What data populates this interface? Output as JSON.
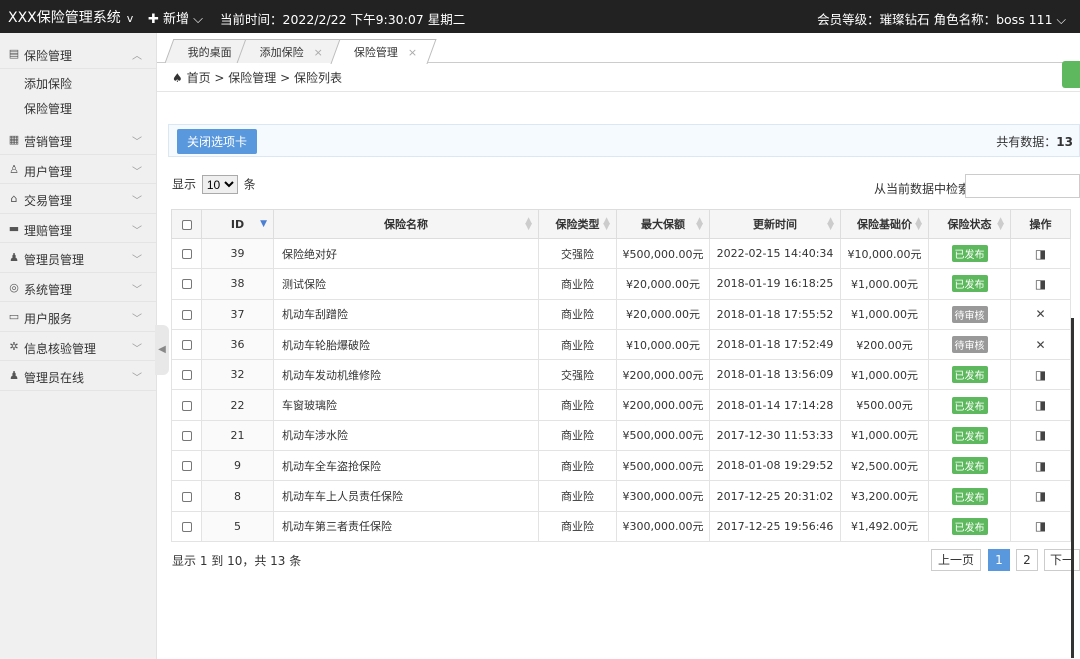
{
  "topbar": {
    "brand": "XXX保险管理系统",
    "brand_caret": "v",
    "new_label": "✚ 新增 ⌵",
    "time_label": "当前时间：2022/2/22 下午9:30:07 星期二",
    "member_label": "会员等级：璀璨钻石 角色名称：boss  111 ⌵"
  },
  "sidebar": {
    "items": [
      {
        "label": "保险管理",
        "icon": "insurance-icon",
        "glyph": "▤",
        "arrow": "︿"
      },
      {
        "label": "营销管理",
        "icon": "marketing-icon",
        "glyph": "▦",
        "arrow": "﹀"
      },
      {
        "label": "用户管理",
        "icon": "user-icon",
        "glyph": "♙",
        "arrow": "﹀"
      },
      {
        "label": "交易管理",
        "icon": "trade-icon",
        "glyph": "⌂",
        "arrow": "﹀"
      },
      {
        "label": "理赔管理",
        "icon": "claim-icon",
        "glyph": "▬",
        "arrow": "﹀"
      },
      {
        "label": "管理员管理",
        "icon": "admin-icon",
        "glyph": "♟",
        "arrow": "﹀"
      },
      {
        "label": "系统管理",
        "icon": "system-icon",
        "glyph": "◎",
        "arrow": "﹀"
      },
      {
        "label": "用户服务",
        "icon": "service-icon",
        "glyph": "▭",
        "arrow": "﹀"
      },
      {
        "label": "信息核验管理",
        "icon": "verify-icon",
        "glyph": "✲",
        "arrow": "﹀"
      },
      {
        "label": "管理员在线",
        "icon": "online-icon",
        "glyph": "♟",
        "arrow": "﹀"
      }
    ],
    "submenu": [
      "添加保险",
      "保险管理"
    ]
  },
  "tabs": [
    {
      "label": "我的桌面",
      "closable": false
    },
    {
      "label": "添加保险",
      "closable": true
    },
    {
      "label": "保险管理",
      "closable": true,
      "active": true
    }
  ],
  "tab_close_glyph": "×",
  "breadcrumb": "♠ 首页  >  保险管理  >  保险列表",
  "toolbar": {
    "close_tabs": "关闭选项卡",
    "total_label": "共有数据：",
    "total_value": "13"
  },
  "length_menu": {
    "prefix": "显示",
    "value": "10",
    "suffix": "条"
  },
  "search": {
    "label": "从当前数据中检索:",
    "value": ""
  },
  "table": {
    "headers": [
      "ID",
      "保险名称",
      "保险类型",
      "最大保额",
      "更新时间",
      "保险基础价",
      "保险状态",
      "操作"
    ],
    "rows": [
      {
        "id": "39",
        "name": "保险绝对好",
        "type": "交强险",
        "max": "¥500,000.00元",
        "time": "2022-02-15 14:40:34",
        "price": "¥10,000.00元",
        "status": "已发布",
        "op": "publish"
      },
      {
        "id": "38",
        "name": "测试保险",
        "type": "商业险",
        "max": "¥20,000.00元",
        "time": "2018-01-19 16:18:25",
        "price": "¥1,000.00元",
        "status": "已发布",
        "op": "publish"
      },
      {
        "id": "37",
        "name": "机动车刮蹭险",
        "type": "商业险",
        "max": "¥20,000.00元",
        "time": "2018-01-18 17:55:52",
        "price": "¥1,000.00元",
        "status": "待审核",
        "op": "review"
      },
      {
        "id": "36",
        "name": "机动车轮胎爆破险",
        "type": "商业险",
        "max": "¥10,000.00元",
        "time": "2018-01-18 17:52:49",
        "price": "¥200.00元",
        "status": "待审核",
        "op": "review"
      },
      {
        "id": "32",
        "name": "机动车发动机维修险",
        "type": "交强险",
        "max": "¥200,000.00元",
        "time": "2018-01-18 13:56:09",
        "price": "¥1,000.00元",
        "status": "已发布",
        "op": "publish"
      },
      {
        "id": "22",
        "name": "车窗玻璃险",
        "type": "商业险",
        "max": "¥200,000.00元",
        "time": "2018-01-14 17:14:28",
        "price": "¥500.00元",
        "status": "已发布",
        "op": "publish"
      },
      {
        "id": "21",
        "name": "机动车涉水险",
        "type": "商业险",
        "max": "¥500,000.00元",
        "time": "2017-12-30 11:53:33",
        "price": "¥1,000.00元",
        "status": "已发布",
        "op": "publish"
      },
      {
        "id": "9",
        "name": "机动车全车盗抢保险",
        "type": "商业险",
        "max": "¥500,000.00元",
        "time": "2018-01-08 19:29:52",
        "price": "¥2,500.00元",
        "status": "已发布",
        "op": "publish"
      },
      {
        "id": "8",
        "name": "机动车车上人员责任保险",
        "type": "商业险",
        "max": "¥300,000.00元",
        "time": "2017-12-25 20:31:02",
        "price": "¥3,200.00元",
        "status": "已发布",
        "op": "publish"
      },
      {
        "id": "5",
        "name": "机动车第三者责任保险",
        "type": "商业险",
        "max": "¥300,000.00元",
        "time": "2017-12-25 19:56:46",
        "price": "¥1,492.00元",
        "status": "已发布",
        "op": "publish"
      }
    ]
  },
  "status_colors": {
    "已发布": "#5eb95e",
    "待审核": "#999999"
  },
  "op_glyphs": {
    "publish": "◨",
    "review": "✕"
  },
  "footer": {
    "info": "显示 1 到 10，共 13 条",
    "prev": "上一页",
    "pages": [
      "1",
      "2"
    ],
    "next": "下一"
  }
}
